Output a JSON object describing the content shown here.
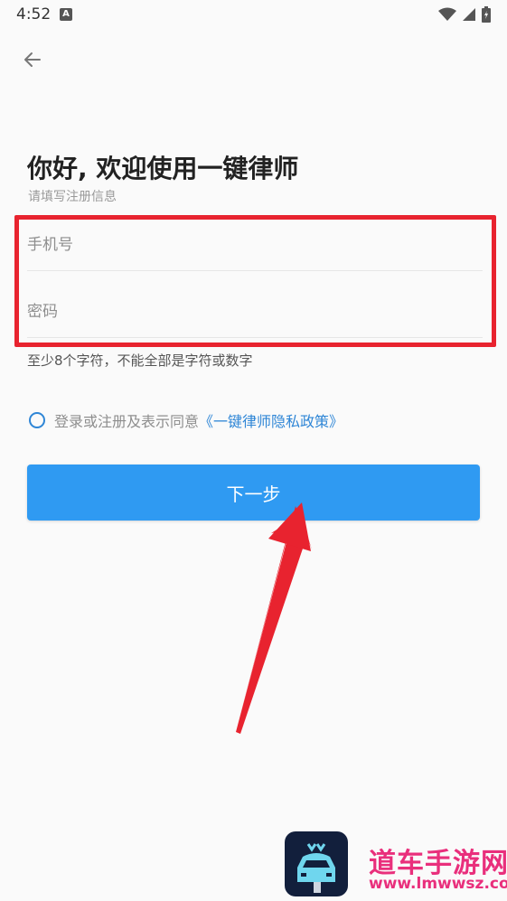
{
  "status_bar": {
    "time": "4:52",
    "notification_icon": "A",
    "icons": [
      "wifi-icon",
      "signal-icon",
      "battery-icon"
    ]
  },
  "header": {
    "back_icon": "arrow-left-icon"
  },
  "main": {
    "title": "你好, 欢迎使用一键律师",
    "subtitle": "请填写注册信息",
    "phone_placeholder": "手机号",
    "password_placeholder": "密码",
    "password_hint": "至少8个字符，不能全部是字符或数字",
    "agreement_text": "登录或注册及表示同意",
    "agreement_link": "《一键律师隐私政策》",
    "next_button": "下一步"
  },
  "annotations": {
    "highlight_color": "#e8232f",
    "arrow_color": "#e8232f"
  },
  "watermark": {
    "line1": "道车手游网",
    "line2": "www.lmwwsz.com"
  },
  "colors": {
    "accent": "#2f9af2",
    "link": "#2f86d6"
  }
}
